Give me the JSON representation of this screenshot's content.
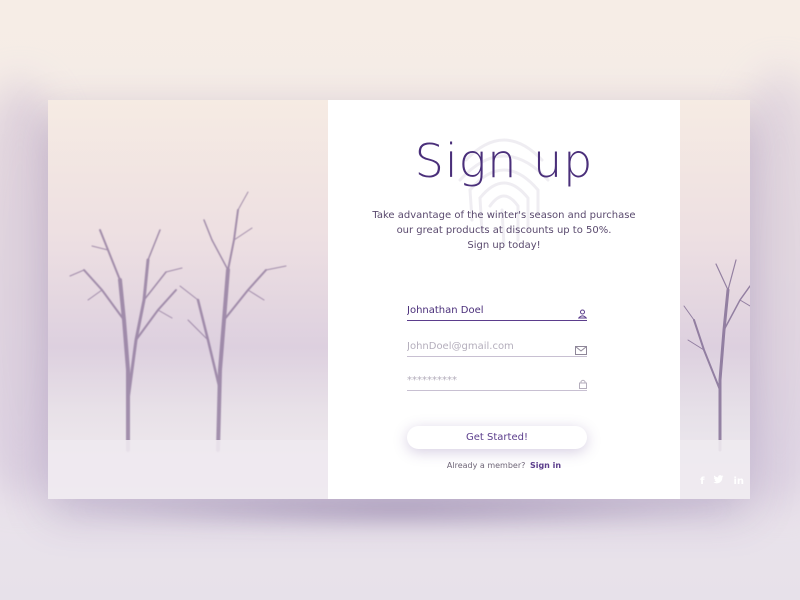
{
  "form": {
    "title": "Sign up",
    "subtitle_lines": [
      "Take advantage of the winter's season and purchase",
      "our great products at discounts up to 50%.",
      "Sign up today!"
    ],
    "name_value": "Johnathan Doel",
    "email_placeholder": "JohnDoel@gmail.com",
    "password_placeholder": "**********",
    "submit_label": "Get Started!",
    "member_prompt": "Already a member?",
    "signin_link": "Sign in"
  },
  "social": {
    "facebook": "f",
    "twitter": "🐦",
    "linkedin": "in"
  },
  "colors": {
    "accent": "#4a2f7a",
    "link": "#5b3d8c",
    "muted": "#b4aebc"
  },
  "icons": {
    "name_field": "user-icon",
    "email_field": "envelope-icon",
    "password_field": "lock-icon",
    "background": "fingerprint-icon"
  }
}
